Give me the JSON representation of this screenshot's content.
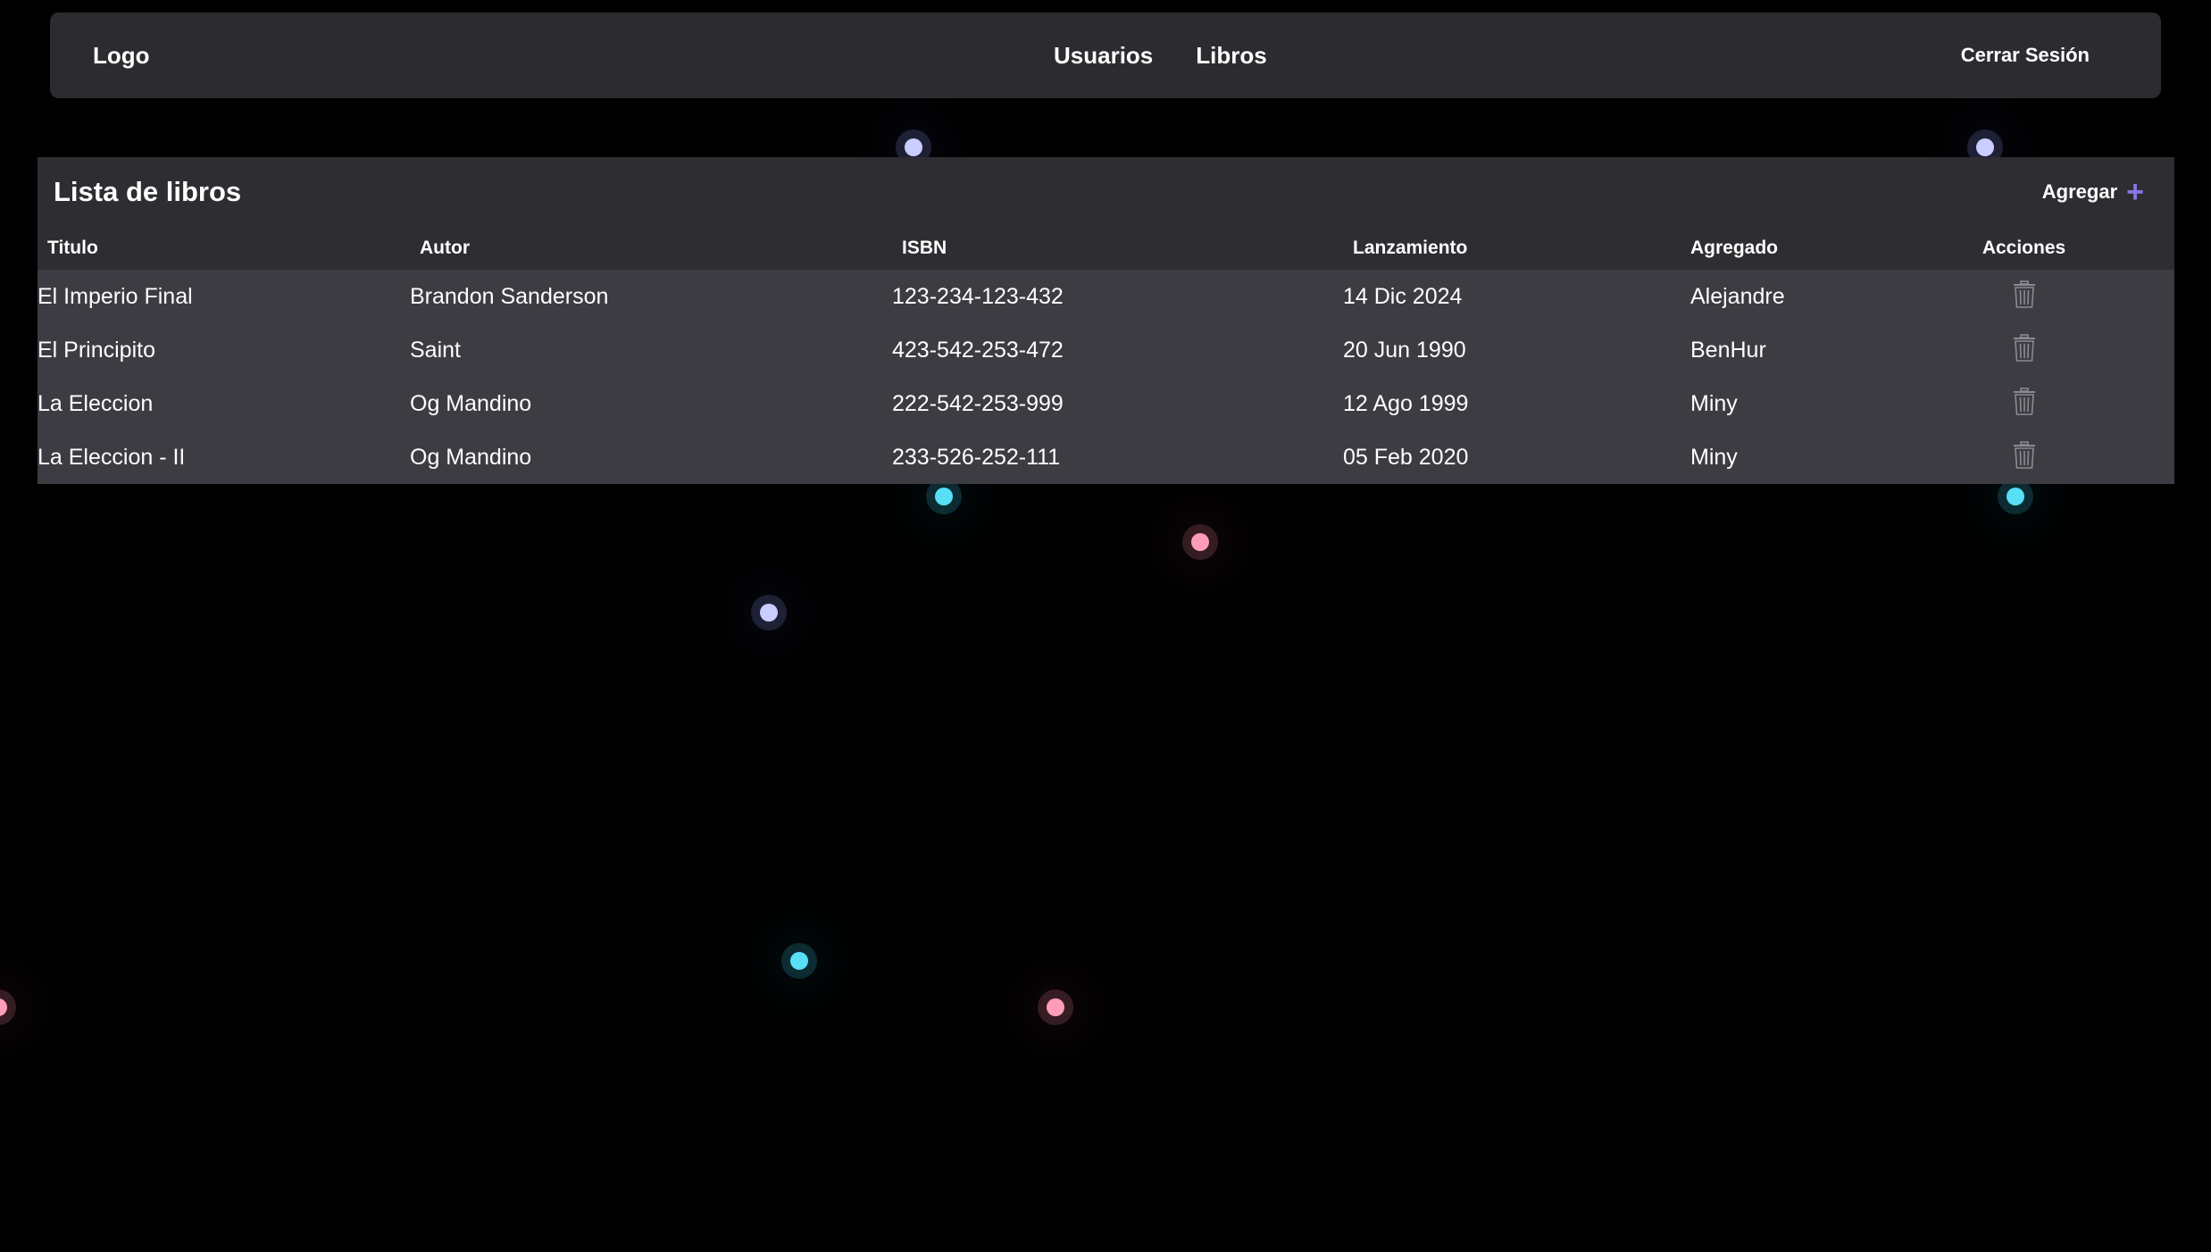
{
  "navbar": {
    "logo": "Logo",
    "links": [
      "Usuarios",
      "Libros"
    ],
    "logout": "Cerrar Sesión"
  },
  "books": {
    "title": "Lista de libros",
    "add_label": "Agregar",
    "add_icon": "plus-icon",
    "columns": [
      "Titulo",
      "Autor",
      "ISBN",
      "Lanzamiento",
      "Agregado",
      "Acciones"
    ],
    "rows": [
      [
        "El Imperio Final",
        "Brandon Sanderson",
        "123-234-123-432",
        "14 Dic 2024",
        "Alejandre"
      ],
      [
        "El Principito",
        "Saint",
        "423-542-253-472",
        "20 Jun 1990",
        "BenHur"
      ],
      [
        "La Eleccion",
        "Og Mandino",
        "222-542-253-999",
        "12 Ago 1999",
        "Miny"
      ],
      [
        "La Eleccion - II",
        "Og Mandino",
        "233-526-252-111",
        "05 Feb 2020",
        "Miny"
      ]
    ],
    "row_action_icon": "trash-icon"
  },
  "colors": {
    "background": "#000000",
    "navbar_bg": "#2c2c30",
    "card_header_bg": "#2e2e32",
    "table_body_bg": "#3c3c42",
    "accent": "#8a76e8",
    "dot_violet": "#c9cdff",
    "dot_cyan": "#56dff7",
    "dot_pink": "#ff9db8"
  }
}
